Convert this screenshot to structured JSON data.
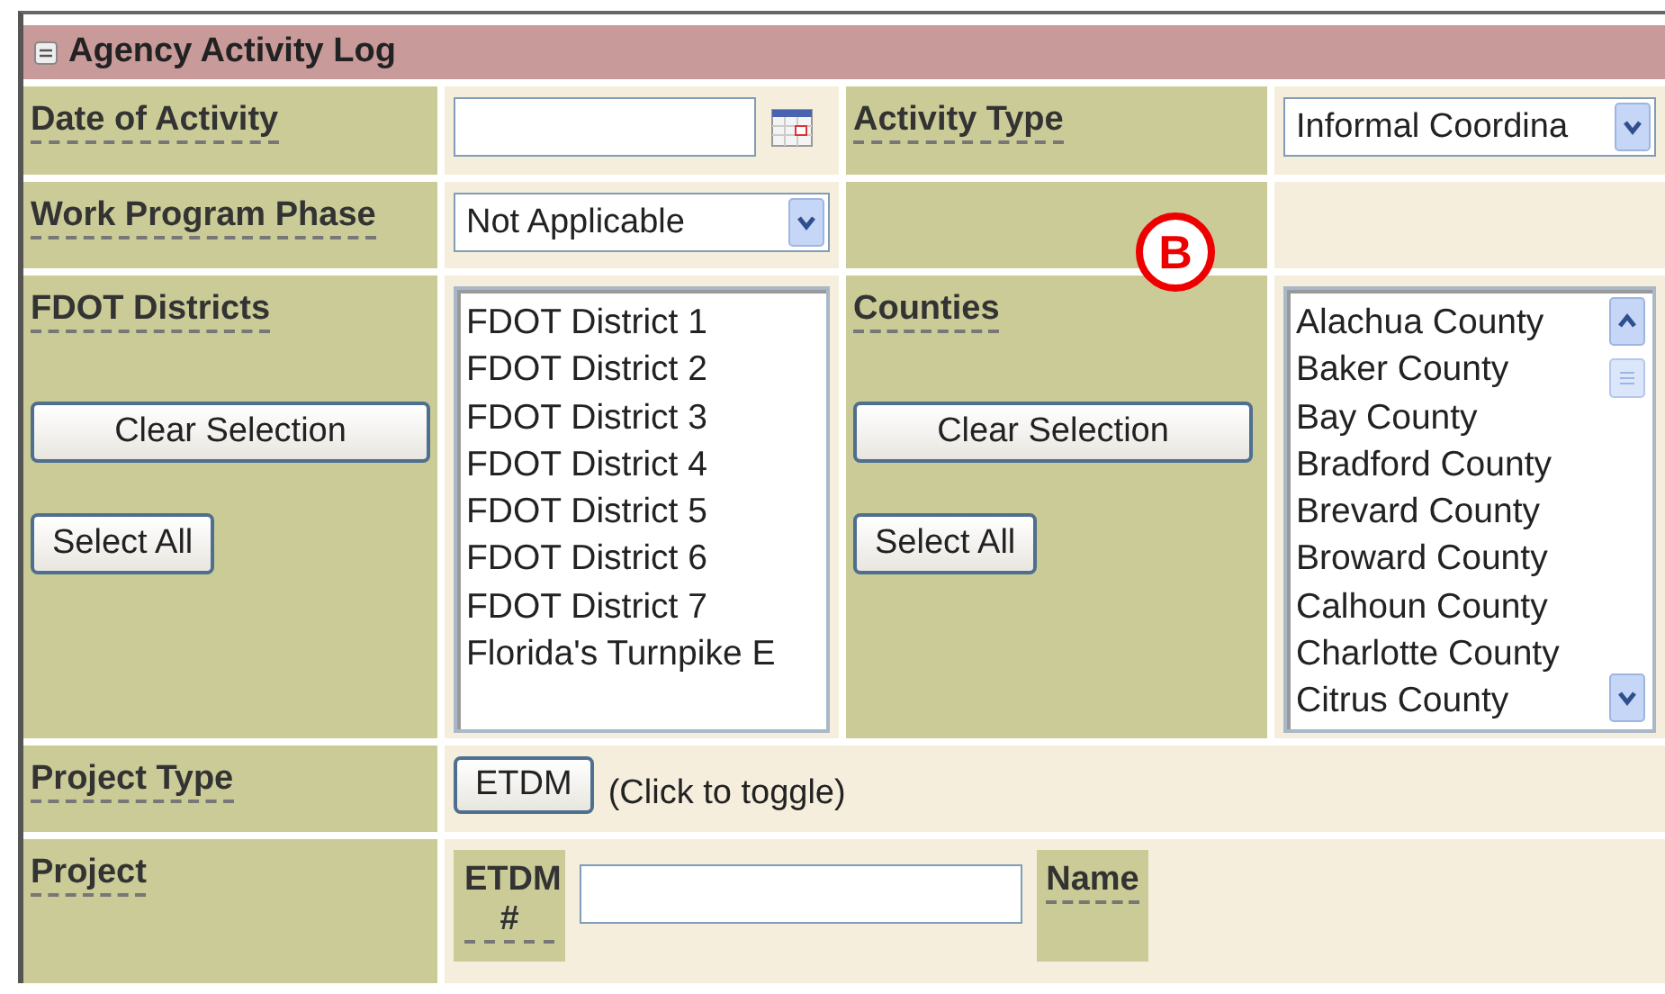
{
  "panel": {
    "title": "Agency Activity Log",
    "expanded": true
  },
  "date_of_activity": {
    "label": "Date of Activity"
  },
  "activity_type": {
    "label": "Activity Type",
    "value": "Informal Coordina"
  },
  "work_program_phase": {
    "label": "Work Program Phase",
    "value": "Not Applicable"
  },
  "annotation": {
    "text": "B"
  },
  "fdot_districts": {
    "label": "FDOT Districts",
    "buttons": [
      "Clear Selection",
      "Select All"
    ],
    "items": [
      {
        "text": "FDOT District 1",
        "selected": false
      },
      {
        "text": "FDOT District 2",
        "selected": false
      },
      {
        "text": "FDOT District 3",
        "selected": false
      },
      {
        "text": "FDOT District 4",
        "selected": false
      },
      {
        "text": "FDOT District 5",
        "selected": false
      },
      {
        "text": "FDOT District 6",
        "selected": false
      },
      {
        "text": "FDOT District 7",
        "selected": false
      },
      {
        "text": "Florida's Turnpike E",
        "selected": false
      }
    ]
  },
  "counties": {
    "label": "Counties",
    "buttons": [
      "Clear Selection",
      "Select All"
    ],
    "items": [
      {
        "text": "Alachua County",
        "selected": false
      },
      {
        "text": "Baker County",
        "selected": false
      },
      {
        "text": "Bay County",
        "selected": false
      },
      {
        "text": "Bradford County",
        "selected": false
      },
      {
        "text": "Brevard County",
        "selected": false
      },
      {
        "text": "Broward County",
        "selected": false
      },
      {
        "text": "Calhoun County",
        "selected": false
      },
      {
        "text": "Charlotte County",
        "selected": false
      },
      {
        "text": "Citrus County",
        "selected": false
      }
    ]
  },
  "project_type": {
    "label": "Project Type",
    "button": "ETDM",
    "hint": "(Click to toggle)"
  },
  "project": {
    "label": "Project",
    "etdm_label": "ETDM #",
    "name_label": "Name"
  }
}
